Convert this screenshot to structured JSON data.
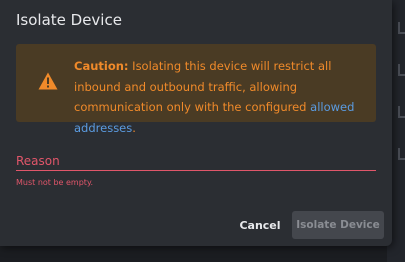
{
  "dialog": {
    "title": "Isolate Device"
  },
  "caution": {
    "icon": "warning-triangle-icon",
    "label": "Caution:",
    "text": " Isolating this device will restrict all inbound and outbound traffic, allowing communication only with the configured ",
    "link_text": "allowed addresses",
    "suffix": "."
  },
  "reason_field": {
    "placeholder": "Reason",
    "value": "",
    "error": "Must not be empty."
  },
  "actions": {
    "cancel_label": "Cancel",
    "isolate_label": "Isolate Device",
    "isolate_enabled": false
  },
  "colors": {
    "dialog_bg": "#2b2e33",
    "warning": "#f08a2a",
    "warning_bg": "#4a3b24",
    "link": "#5b9be0",
    "error": "#e0566a"
  }
}
